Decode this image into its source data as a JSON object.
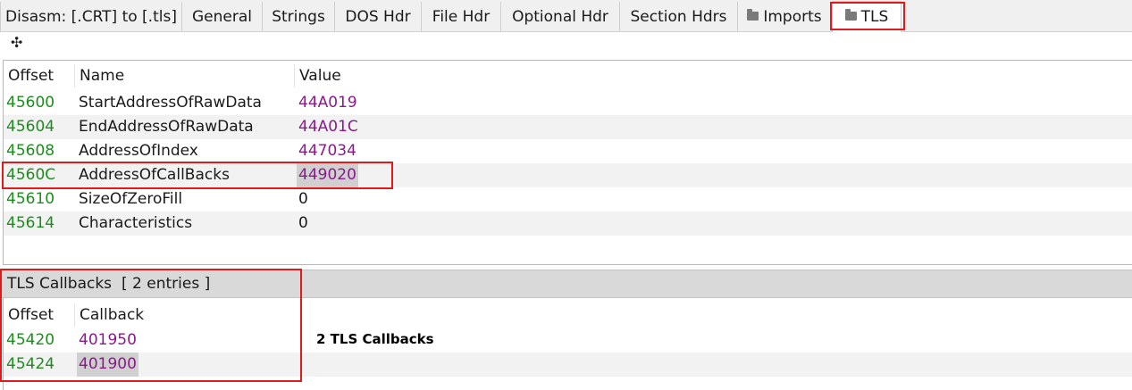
{
  "tabs": [
    {
      "label": "Disasm: [.CRT] to [.tls]",
      "icon": null,
      "active": false
    },
    {
      "label": "General",
      "icon": null,
      "active": false
    },
    {
      "label": "Strings",
      "icon": null,
      "active": false
    },
    {
      "label": "DOS Hdr",
      "icon": null,
      "active": false
    },
    {
      "label": "File Hdr",
      "icon": null,
      "active": false
    },
    {
      "label": "Optional Hdr",
      "icon": null,
      "active": false
    },
    {
      "label": "Section Hdrs",
      "icon": null,
      "active": false
    },
    {
      "label": "Imports",
      "icon": "folder-icon",
      "active": false
    },
    {
      "label": "TLS",
      "icon": "folder-icon",
      "active": true
    }
  ],
  "toolbar": {
    "icon": "move-icon",
    "glyph": "✣"
  },
  "tls_table": {
    "headers": [
      "Offset",
      "Name",
      "Value"
    ],
    "rows": [
      {
        "offset": "45600",
        "name": "StartAddressOfRawData",
        "value": "44A019",
        "value_color": "purple"
      },
      {
        "offset": "45604",
        "name": "EndAddressOfRawData",
        "value": "44A01C",
        "value_color": "purple"
      },
      {
        "offset": "45608",
        "name": "AddressOfIndex",
        "value": "447034",
        "value_color": "purple"
      },
      {
        "offset": "4560C",
        "name": "AddressOfCallBacks",
        "value": "449020",
        "value_color": "purple",
        "selected": true
      },
      {
        "offset": "45610",
        "name": "SizeOfZeroFill",
        "value": "0",
        "value_color": "default"
      },
      {
        "offset": "45614",
        "name": "Characteristics",
        "value": "0",
        "value_color": "default"
      }
    ]
  },
  "callbacks": {
    "title": "TLS Callbacks",
    "count_label": "[ 2 entries ]",
    "headers": [
      "Offset",
      "Callback"
    ],
    "rows": [
      {
        "offset": "45420",
        "callback": "401950"
      },
      {
        "offset": "45424",
        "callback": "401900",
        "selected": true
      }
    ]
  },
  "annotation": "2 TLS Callbacks",
  "colors": {
    "offset": "#1f8c1f",
    "address": "#8a1a8a",
    "highlight": "#e01b1b"
  }
}
